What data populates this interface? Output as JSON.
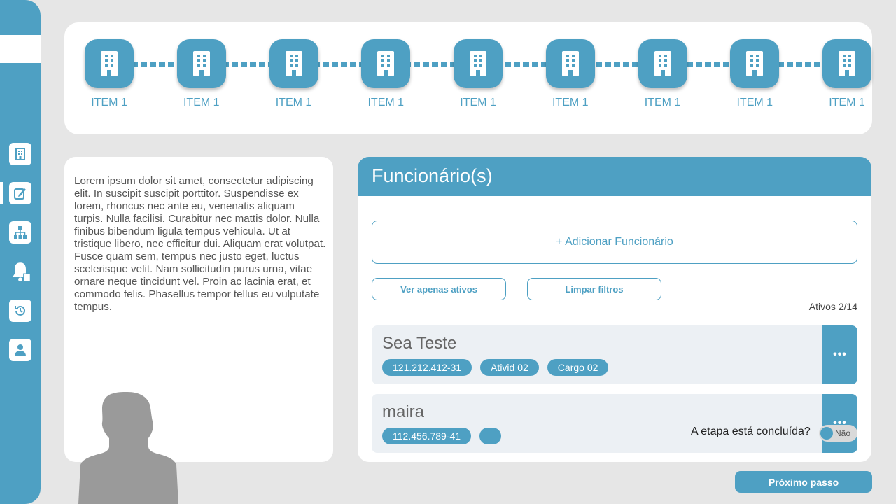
{
  "sidebar": {
    "icons": [
      "building-icon",
      "edit-icon",
      "org-chart-icon",
      "notification-document-icon",
      "history-icon",
      "user-icon"
    ]
  },
  "stepper": {
    "items": [
      {
        "label": "ITEM 1"
      },
      {
        "label": "ITEM 1"
      },
      {
        "label": "ITEM 1"
      },
      {
        "label": "ITEM 1"
      },
      {
        "label": "ITEM 1"
      },
      {
        "label": "ITEM 1"
      },
      {
        "label": "ITEM 1"
      },
      {
        "label": "ITEM 1"
      },
      {
        "label": "ITEM 1"
      }
    ],
    "icon": "building-icon"
  },
  "info": {
    "text": "Lorem ipsum dolor sit amet, consectetur adipiscing elit. In suscipit suscipit porttitor. Suspendisse ex lorem, rhoncus nec ante eu, venenatis aliquam turpis. Nulla facilisi. Curabitur nec mattis dolor. Nulla finibus bibendum ligula tempus vehicula. Ut at tristique libero, nec efficitur dui. Aliquam erat volutpat. Fusce quam sem, tempus nec justo eget, luctus scelerisque velit. Nam sollicitudin purus urna, vitae ornare neque tincidunt vel. Proin ac lacinia erat, et commodo felis. Phasellus tempor tellus eu vulputate tempus."
  },
  "employees": {
    "title": "Funcionário(s)",
    "add_label": "+ Adicionar Funcionário",
    "filter_active_label": "Ver apenas ativos",
    "clear_filters_label": "Limpar filtros",
    "active_count": "Ativos 2/14",
    "list": [
      {
        "name": "Sea Teste",
        "tags": [
          "121.212.412-31",
          "Ativid 02",
          "Cargo 02"
        ]
      },
      {
        "name": "maira",
        "tags": [
          "112.456.789-41",
          ""
        ]
      }
    ],
    "more_label": "•••"
  },
  "step_status": {
    "question": "A etapa está concluída?",
    "toggle_label": "Não"
  },
  "footer": {
    "next_label": "Próximo passo"
  },
  "colors": {
    "accent": "#4ea0c3",
    "background": "#e6e6e6",
    "card": "#ffffff",
    "employee_card": "#ecf0f4"
  }
}
